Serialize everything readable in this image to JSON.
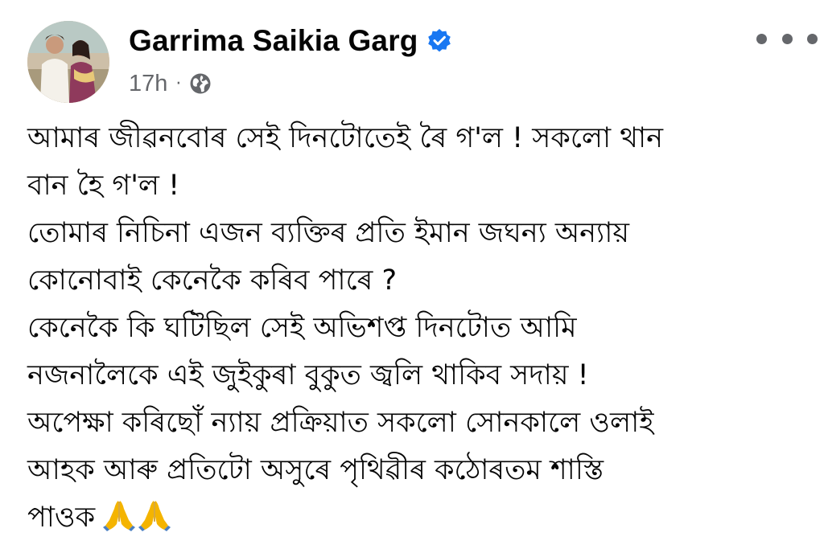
{
  "post": {
    "author": {
      "name": "Garrima Saikia Garg",
      "verified": true,
      "avatar": "couple-photo"
    },
    "meta": {
      "time": "17h",
      "separator": "·",
      "audience_icon": "globe-icon"
    },
    "menu_icon": "more-options-icon",
    "body_lines": [
      "আমাৰ জীৱনবোৰ সেই দিনটোতেই ৰৈ গ'ল ! সকলো থান",
      "বান হৈ গ'ল !",
      "তোমাৰ নিচিনা এজন ব্যক্তিৰ প্ৰতি ইমান জঘন্য অন্যায়",
      "কোনোবাই কেনেকৈ কৰিব পাৰে ?",
      "কেনেকৈ কি ঘটিছিল সেই অভিশপ্ত দিনটোত আমি",
      "নজনালৈকে এই জুইকুৰা বুকুত জ্বলি থাকিব সদায় !",
      "অপেক্ষা কৰিছোঁ ন্যায় প্ৰক্ৰিয়াত সকলো সোনকালে ওলাই",
      "আহক আৰু প্ৰতিটো অসুৰে পৃথিৱীৰ কঠোৰতম শাস্তি",
      "পাওক"
    ],
    "emoji": [
      "folded-hands-icon",
      "folded-hands-icon"
    ],
    "colors": {
      "text": "#050505",
      "secondary": "#65676b",
      "verified_blue": "#1877f2",
      "emoji_skin": "#f4b400"
    }
  }
}
